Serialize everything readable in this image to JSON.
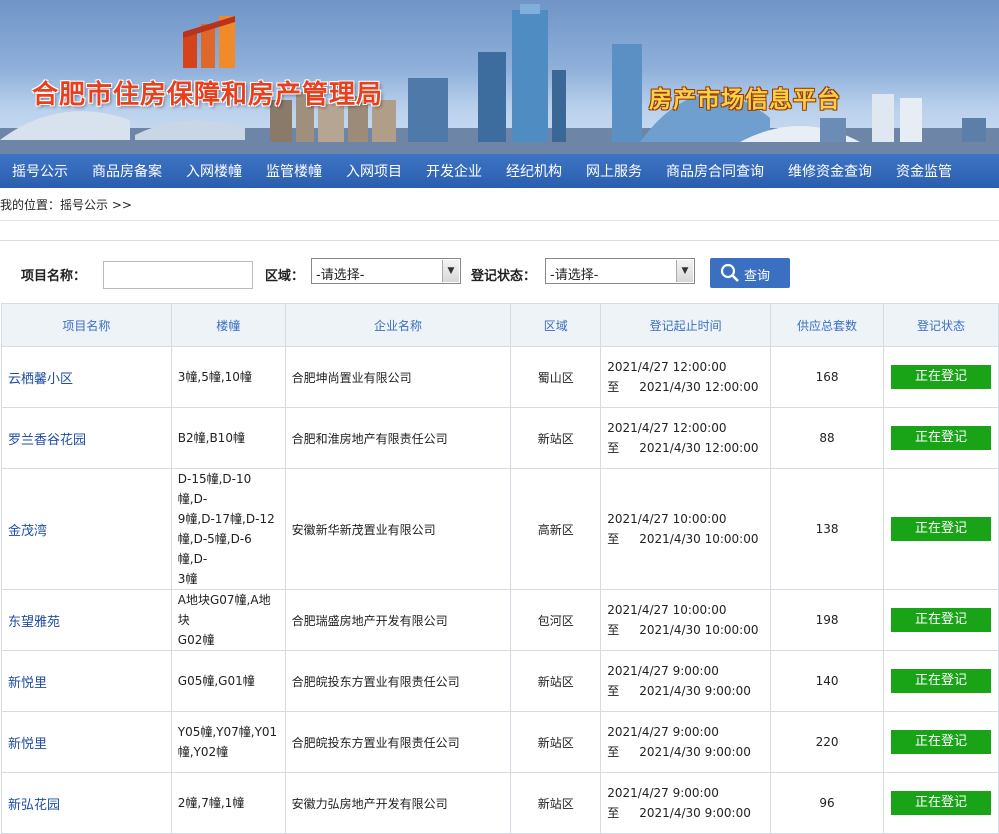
{
  "banner": {
    "site_title": "合肥市住房保障和房产管理局",
    "platform_title": "房产市场信息平台"
  },
  "nav": [
    "摇号公示",
    "商品房备案",
    "入网楼幢",
    "监管楼幢",
    "入网项目",
    "开发企业",
    "经纪机构",
    "网上服务",
    "商品房合同查询",
    "维修资金查询",
    "资金监管"
  ],
  "breadcrumb": "我的位置：摇号公示 >>",
  "search": {
    "project_label": "项目名称：",
    "project_value": "",
    "area_label": "区域：",
    "area_selected": "-请选择-",
    "status_label": "登记状态：",
    "status_selected": "-请选择-",
    "query_button": "查询"
  },
  "table": {
    "headers": [
      "项目名称",
      "楼幢",
      "企业名称",
      "区域",
      "登记起止时间",
      "供应总套数",
      "登记状态"
    ],
    "rows": [
      {
        "name": "云栖馨小区",
        "buildings": [
          "3幢,5幢,10幢"
        ],
        "company": "合肥坤尚置业有限公司",
        "area": "蜀山区",
        "start": "2021/4/27 12:00:00",
        "to": "至",
        "end": "2021/4/30 12:00:00",
        "units": "168",
        "status": "正在登记"
      },
      {
        "name": "罗兰香谷花园",
        "buildings": [
          "B2幢,B10幢"
        ],
        "company": "合肥和淮房地产有限责任公司",
        "area": "新站区",
        "start": "2021/4/27 12:00:00",
        "to": "至",
        "end": "2021/4/30 12:00:00",
        "units": "88",
        "status": "正在登记"
      },
      {
        "name": "金茂湾",
        "buildings": [
          "D-15幢,D-10幢,D-",
          "9幢,D-17幢,D-12",
          "幢,D-5幢,D-6幢,D-",
          "3幢"
        ],
        "company": "安徽新华新茂置业有限公司",
        "area": "高新区",
        "start": "2021/4/27 10:00:00",
        "to": "至",
        "end": "2021/4/30 10:00:00",
        "units": "138",
        "status": "正在登记"
      },
      {
        "name": "东望雅苑",
        "buildings": [
          "A地块G07幢,A地块",
          "G02幢"
        ],
        "company": "合肥瑞盛房地产开发有限公司",
        "area": "包河区",
        "start": "2021/4/27 10:00:00",
        "to": "至",
        "end": "2021/4/30 10:00:00",
        "units": "198",
        "status": "正在登记"
      },
      {
        "name": "新悦里",
        "buildings": [
          "G05幢,G01幢"
        ],
        "company": "合肥皖投东方置业有限责任公司",
        "area": "新站区",
        "start": "2021/4/27 9:00:00",
        "to": "至",
        "end": "2021/4/30 9:00:00",
        "units": "140",
        "status": "正在登记"
      },
      {
        "name": "新悦里",
        "buildings": [
          "Y05幢,Y07幢,Y01",
          "幢,Y02幢"
        ],
        "company": "合肥皖投东方置业有限责任公司",
        "area": "新站区",
        "start": "2021/4/27 9:00:00",
        "to": "至",
        "end": "2021/4/30 9:00:00",
        "units": "220",
        "status": "正在登记"
      },
      {
        "name": "新弘花园",
        "buildings": [
          "2幢,7幢,1幢"
        ],
        "company": "安徽力弘房地产开发有限公司",
        "area": "新站区",
        "start": "2021/4/27 9:00:00",
        "to": "至",
        "end": "2021/4/30 9:00:00",
        "units": "96",
        "status": "正在登记"
      }
    ]
  }
}
